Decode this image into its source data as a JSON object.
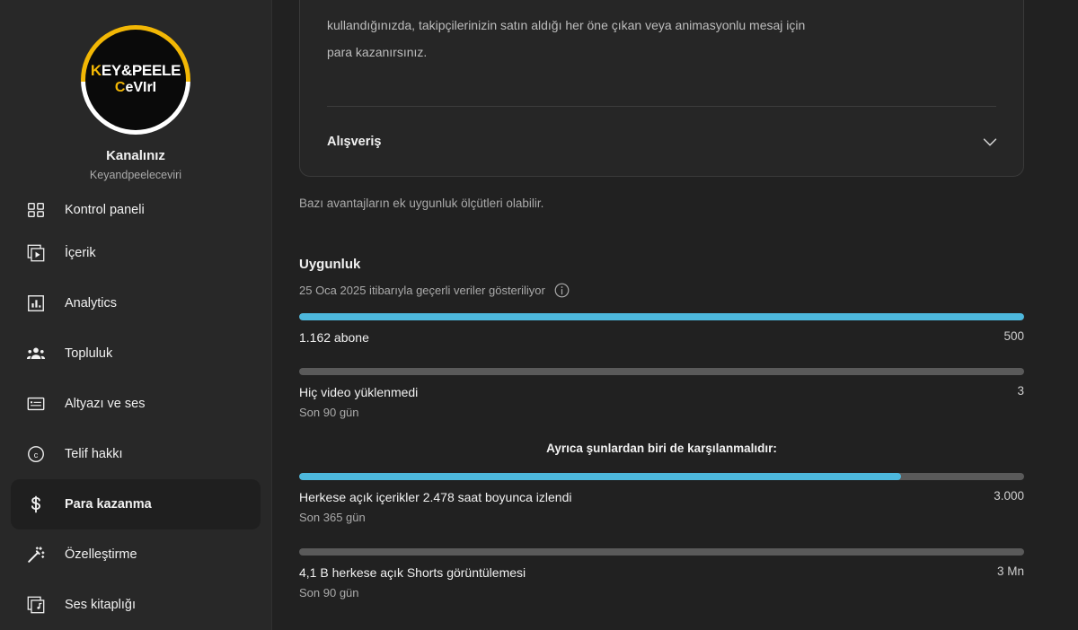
{
  "sidebar": {
    "channel": {
      "avatar_logo_line1_accent": "K",
      "avatar_logo_line1_rest": "EY&PEELE",
      "avatar_logo_line2_accent": "C",
      "avatar_logo_line2_rest": "eVIrI",
      "title": "Kanalınız",
      "handle": "Keyandpeeleceviri",
      "ring_color_primary": "#f2b705",
      "ring_color_secondary": "#ffffff"
    },
    "items": [
      {
        "label": "Kontrol paneli",
        "icon": "dashboard-icon",
        "active": false
      },
      {
        "label": "İçerik",
        "icon": "content-icon",
        "active": false
      },
      {
        "label": "Analytics",
        "icon": "analytics-icon",
        "active": false
      },
      {
        "label": "Topluluk",
        "icon": "community-icon",
        "active": false
      },
      {
        "label": "Altyazı ve ses",
        "icon": "subtitles-icon",
        "active": false
      },
      {
        "label": "Telif hakkı",
        "icon": "copyright-icon",
        "active": false
      },
      {
        "label": "Para kazanma",
        "icon": "dollar-icon",
        "active": true
      },
      {
        "label": "Özelleştirme",
        "icon": "magic-wand-icon",
        "active": false
      },
      {
        "label": "Ses kitaplığı",
        "icon": "audio-library-icon",
        "active": false
      }
    ]
  },
  "main": {
    "promo_card": {
      "body_text": "kullandığınızda, takipçilerinizin satın aldığı her öne çıkan veya animasyonlu mesaj için para kazanırsınız.",
      "expand_row_label": "Alışveriş",
      "expand_icon": "chevron-down-icon",
      "illustration": "purple-plant-in-pot-illustration"
    },
    "note": "Bazı avantajların ek uygunluk ölçütleri olabilir.",
    "eligibility": {
      "title": "Uygunluk",
      "as_of_text": "25 Oca 2025 itibarıyla geçerli veriler gösteriliyor",
      "info_icon": "info-icon",
      "alternative_note": "Ayrıca şunlardan biri de karşılanmalıdır:",
      "accent_color": "#4db8dd",
      "track_color": "#5a5a5a",
      "metrics": [
        {
          "label": "1.162 abone",
          "sub": "",
          "value": "500",
          "progress_percent": 100
        },
        {
          "label": "Hiç video yüklenmedi",
          "sub": "Son 90 gün",
          "value": "3",
          "progress_percent": 0
        },
        {
          "label": "Herkese açık içerikler 2.478 saat boyunca izlendi",
          "sub": "Son 365 gün",
          "value": "3.000",
          "progress_percent": 83
        },
        {
          "label": "4,1 B herkese açık Shorts görüntülemesi",
          "sub": "Son 90 gün",
          "value": "3 Mn",
          "progress_percent": 0
        }
      ]
    }
  }
}
